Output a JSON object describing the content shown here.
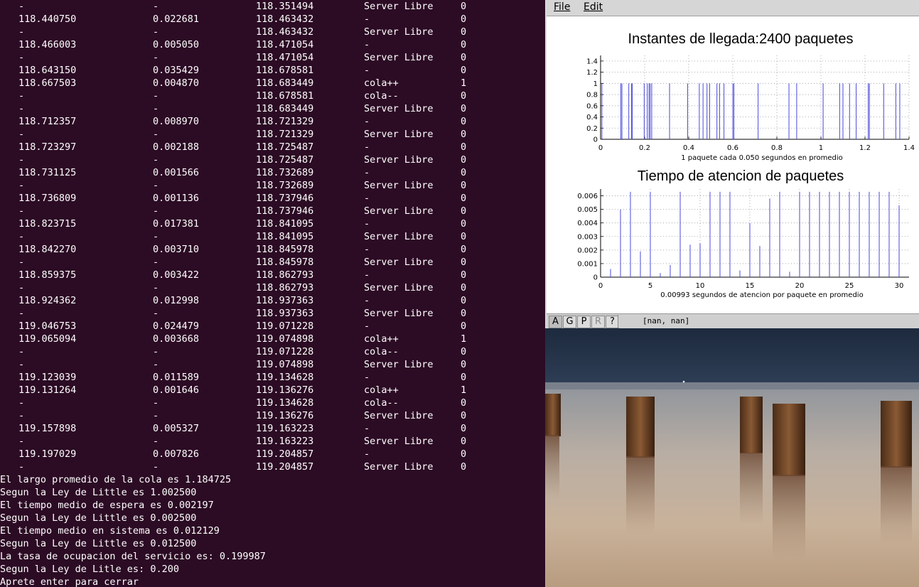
{
  "terminal": {
    "rows": [
      [
        "",
        "-",
        "-",
        "118.351494",
        "Server Libre",
        "0"
      ],
      [
        "",
        "118.440750",
        "0.022681",
        "118.463432",
        "-",
        "0"
      ],
      [
        "",
        "-",
        "-",
        "118.463432",
        "Server Libre",
        "0"
      ],
      [
        "",
        "118.466003",
        "0.005050",
        "118.471054",
        "-",
        "0"
      ],
      [
        "",
        "-",
        "-",
        "118.471054",
        "Server Libre",
        "0"
      ],
      [
        "",
        "118.643150",
        "0.035429",
        "118.678581",
        "-",
        "0"
      ],
      [
        "",
        "118.667503",
        "0.004870",
        "118.683449",
        "cola++",
        "1"
      ],
      [
        "",
        "-",
        "-",
        "118.678581",
        "cola--",
        "0"
      ],
      [
        "",
        "-",
        "-",
        "118.683449",
        "Server Libre",
        "0"
      ],
      [
        "",
        "118.712357",
        "0.008970",
        "118.721329",
        "-",
        "0"
      ],
      [
        "",
        "-",
        "-",
        "118.721329",
        "Server Libre",
        "0"
      ],
      [
        "",
        "118.723297",
        "0.002188",
        "118.725487",
        "-",
        "0"
      ],
      [
        "",
        "-",
        "-",
        "118.725487",
        "Server Libre",
        "0"
      ],
      [
        "",
        "118.731125",
        "0.001566",
        "118.732689",
        "-",
        "0"
      ],
      [
        "",
        "-",
        "-",
        "118.732689",
        "Server Libre",
        "0"
      ],
      [
        "",
        "118.736809",
        "0.001136",
        "118.737946",
        "-",
        "0"
      ],
      [
        "",
        "-",
        "-",
        "118.737946",
        "Server Libre",
        "0"
      ],
      [
        "",
        "118.823715",
        "0.017381",
        "118.841095",
        "-",
        "0"
      ],
      [
        "",
        "-",
        "-",
        "118.841095",
        "Server Libre",
        "0"
      ],
      [
        "",
        "118.842270",
        "0.003710",
        "118.845978",
        "-",
        "0"
      ],
      [
        "",
        "-",
        "-",
        "118.845978",
        "Server Libre",
        "0"
      ],
      [
        "",
        "118.859375",
        "0.003422",
        "118.862793",
        "-",
        "0"
      ],
      [
        "",
        "-",
        "-",
        "118.862793",
        "Server Libre",
        "0"
      ],
      [
        "",
        "118.924362",
        "0.012998",
        "118.937363",
        "-",
        "0"
      ],
      [
        "",
        "-",
        "-",
        "118.937363",
        "Server Libre",
        "0"
      ],
      [
        "",
        "119.046753",
        "0.024479",
        "119.071228",
        "-",
        "0"
      ],
      [
        "",
        "119.065094",
        "0.003668",
        "119.074898",
        "cola++",
        "1"
      ],
      [
        "",
        "-",
        "-",
        "119.071228",
        "cola--",
        "0"
      ],
      [
        "",
        "-",
        "-",
        "119.074898",
        "Server Libre",
        "0"
      ],
      [
        "",
        "119.123039",
        "0.011589",
        "119.134628",
        "-",
        "0"
      ],
      [
        "",
        "119.131264",
        "0.001646",
        "119.136276",
        "cola++",
        "1"
      ],
      [
        "",
        "-",
        "-",
        "119.134628",
        "cola--",
        "0"
      ],
      [
        "",
        "-",
        "-",
        "119.136276",
        "Server Libre",
        "0"
      ],
      [
        "",
        "119.157898",
        "0.005327",
        "119.163223",
        "-",
        "0"
      ],
      [
        "",
        "-",
        "-",
        "119.163223",
        "Server Libre",
        "0"
      ],
      [
        "",
        "119.197029",
        "0.007826",
        "119.204857",
        "-",
        "0"
      ],
      [
        "",
        "-",
        "-",
        "119.204857",
        "Server Libre",
        "0"
      ]
    ],
    "summary": [
      "El largo promedio de la cola es 1.184725",
      "Segun la Ley de Little es 1.002500",
      "El tiempo medio de espera es 0.002197",
      "Segun la Ley de Little es 0.002500",
      "El tiempo medio en sistema es 0.012129",
      "Segun la Ley de Little es 0.012500",
      "La tasa de ocupacion del servicio es: 0.199987",
      "Segun la Ley de Litle es: 0.200",
      "Aprete enter para cerrar"
    ]
  },
  "plot_window": {
    "menu": {
      "file": "File",
      "edit": "Edit"
    },
    "toolbar": {
      "a": "A",
      "g": "G",
      "p": "P",
      "r": "R",
      "help": "?",
      "coords": "[nan, nan]"
    }
  },
  "chart_data": [
    {
      "type": "bar",
      "title": "Instantes de llegada:2400 paquetes",
      "xlabel": "1 paquete cada 0.050 segundos en promedio",
      "ylabel": "",
      "xlim": [
        0,
        1.4
      ],
      "ylim": [
        0,
        1.5
      ],
      "xticks": [
        "0",
        "0.2",
        "0.4",
        "0.6",
        "0.8",
        "1",
        "1.2",
        "1.4"
      ],
      "yticks": [
        "0",
        "0.2",
        "0.4",
        "0.6",
        "0.8",
        "1",
        "1.2",
        "1.4"
      ],
      "grid": true,
      "color": "#4a4adc",
      "x": [
        0.006,
        0.092,
        0.097,
        0.128,
        0.14,
        0.144,
        0.198,
        0.212,
        0.22,
        0.225,
        0.232,
        0.313,
        0.395,
        0.448,
        0.465,
        0.483,
        0.495,
        0.528,
        0.54,
        0.56,
        0.6,
        0.605,
        0.715,
        0.855,
        0.89,
        1.01,
        1.085,
        1.1,
        1.13,
        1.16,
        1.215,
        1.22,
        1.285,
        1.34,
        1.358
      ],
      "values": [
        1,
        1,
        1,
        1,
        1,
        1,
        1,
        1,
        1,
        1,
        1,
        1,
        1,
        1,
        1,
        1,
        1,
        1,
        1,
        1,
        1,
        1,
        1,
        1,
        1,
        1,
        1,
        1,
        1,
        1,
        1,
        1,
        1,
        1,
        1
      ]
    },
    {
      "type": "bar",
      "title": "Tiempo de atencion de paquetes",
      "xlabel": "0.00993 segundos de atencion por paquete en promedio",
      "ylabel": "",
      "xlim": [
        0,
        31
      ],
      "ylim": [
        0,
        0.0065
      ],
      "xticks": [
        "0",
        "5",
        "10",
        "15",
        "20",
        "25",
        "30"
      ],
      "yticks": [
        "0",
        "0.001",
        "0.002",
        "0.003",
        "0.004",
        "0.005",
        "0.006"
      ],
      "grid": true,
      "color": "#4a4adc",
      "x": [
        1,
        2,
        3,
        4,
        5,
        6,
        7,
        8,
        9,
        10,
        11,
        12,
        13,
        14,
        15,
        16,
        17,
        18,
        19,
        20,
        21,
        22,
        23,
        24,
        25,
        26,
        27,
        28,
        29,
        30
      ],
      "values": [
        0.0006,
        0.005,
        0.0063,
        0.0019,
        0.0063,
        0.0003,
        0.0009,
        0.0063,
        0.0024,
        0.0025,
        0.0063,
        0.0063,
        0.0063,
        0.0005,
        0.004,
        0.0023,
        0.0058,
        0.0063,
        0.0004,
        0.0063,
        0.0063,
        0.0063,
        0.0063,
        0.0063,
        0.0063,
        0.0063,
        0.0063,
        0.0063,
        0.0063,
        0.0053
      ]
    }
  ]
}
